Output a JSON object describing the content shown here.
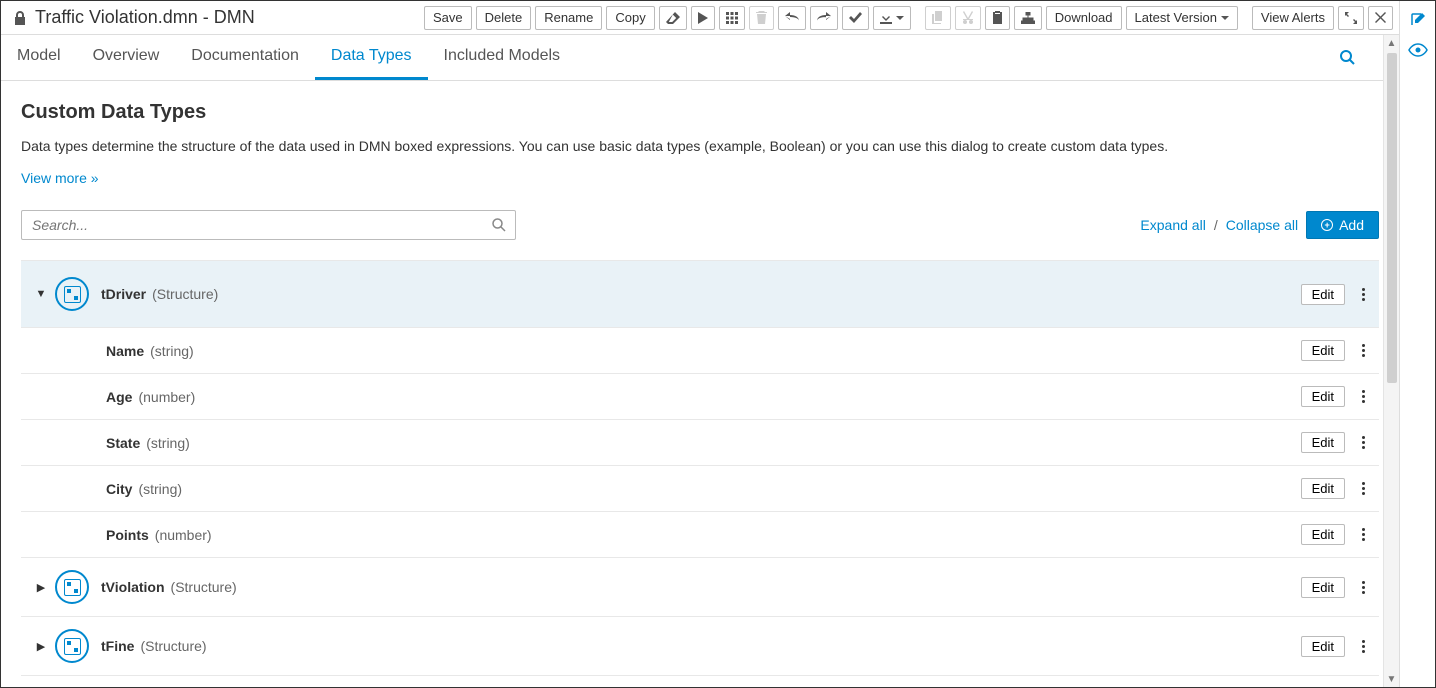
{
  "header": {
    "title": "Traffic Violation.dmn - DMN"
  },
  "toolbar": {
    "save": "Save",
    "delete": "Delete",
    "rename": "Rename",
    "copy": "Copy",
    "download": "Download",
    "latest_version": "Latest Version",
    "view_alerts": "View Alerts"
  },
  "tabs": [
    {
      "label": "Model",
      "active": false
    },
    {
      "label": "Overview",
      "active": false
    },
    {
      "label": "Documentation",
      "active": false
    },
    {
      "label": "Data Types",
      "active": true
    },
    {
      "label": "Included Models",
      "active": false
    }
  ],
  "section": {
    "title": "Custom Data Types",
    "desc": "Data types determine the structure of the data used in DMN boxed expressions. You can use basic data types (example, Boolean) or you can use this dialog to create custom data types.",
    "view_more": "View more »"
  },
  "search": {
    "placeholder": "Search..."
  },
  "controls": {
    "expand_all": "Expand all",
    "collapse_all": "Collapse all",
    "separator": "/",
    "add": "Add"
  },
  "edit_label": "Edit",
  "data_types": [
    {
      "name": "tDriver",
      "type": "(Structure)",
      "expanded": true,
      "fields": [
        {
          "name": "Name",
          "type": "(string)"
        },
        {
          "name": "Age",
          "type": "(number)"
        },
        {
          "name": "State",
          "type": "(string)"
        },
        {
          "name": "City",
          "type": "(string)"
        },
        {
          "name": "Points",
          "type": "(number)"
        }
      ]
    },
    {
      "name": "tViolation",
      "type": "(Structure)",
      "expanded": false,
      "fields": []
    },
    {
      "name": "tFine",
      "type": "(Structure)",
      "expanded": false,
      "fields": []
    }
  ]
}
